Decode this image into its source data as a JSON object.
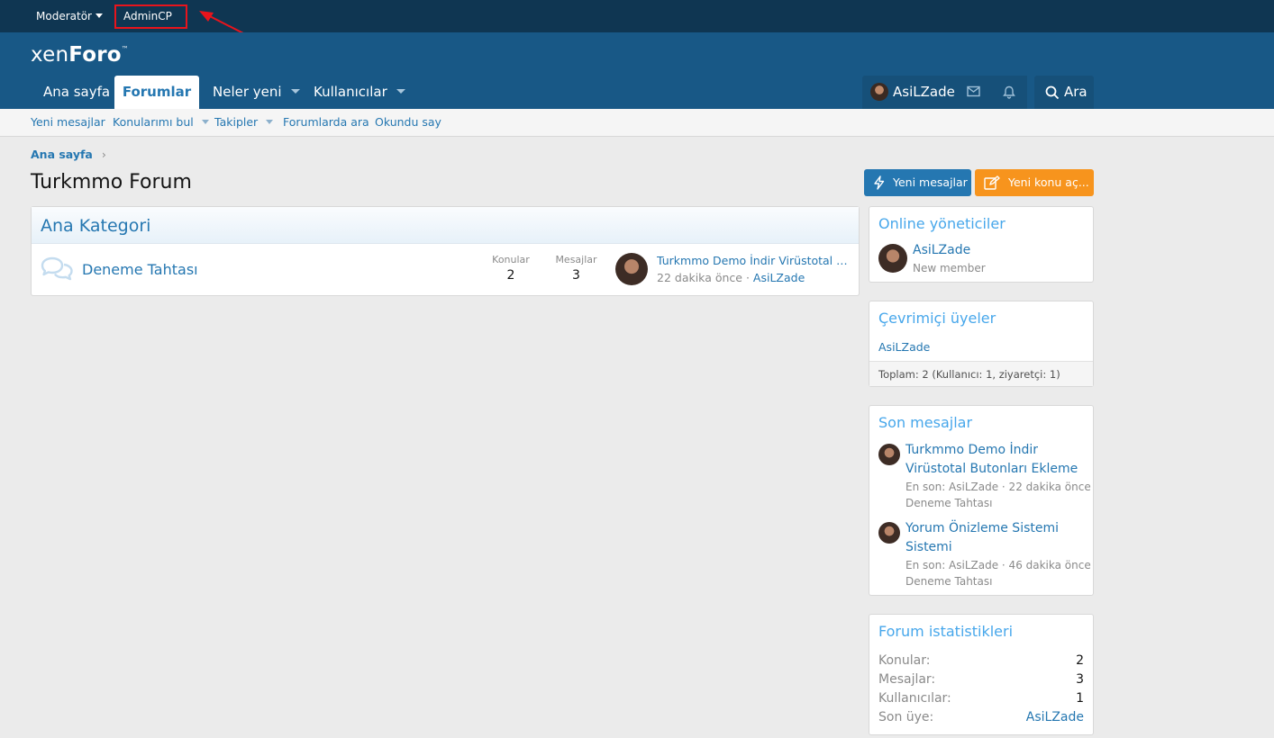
{
  "staff_bar": {
    "moderator_label": "Moderatör",
    "admincp_label": "AdminCP"
  },
  "logo": {
    "part1": "xen",
    "part2": "Foro",
    "tm": "™"
  },
  "nav": {
    "tabs": [
      {
        "label": "Ana sayfa"
      },
      {
        "label": "Forumlar"
      },
      {
        "label": "Neler yeni"
      },
      {
        "label": "Kullanıcılar"
      }
    ],
    "user_label": "AsiLZade",
    "search_label": "Ara"
  },
  "subnav": {
    "items": [
      {
        "label": "Yeni mesajlar"
      },
      {
        "label": "Konularımı bul"
      },
      {
        "label": "Takipler"
      },
      {
        "label": "Forumlarda ara"
      },
      {
        "label": "Okundu say"
      }
    ]
  },
  "breadcrumb": {
    "home": "Ana sayfa",
    "sep": "›"
  },
  "page": {
    "title": "Turkmmo Forum",
    "btn_new_posts": "Yeni mesajlar",
    "btn_new_thread": "Yeni konu aç..."
  },
  "category": {
    "title": "Ana Kategori",
    "forum": {
      "title": "Deneme Tahtası",
      "threads_label": "Konular",
      "threads_value": "2",
      "messages_label": "Mesajlar",
      "messages_value": "3",
      "last_post_title": "Turkmmo Demo İndir Virüstotal Butonları Ekleme",
      "last_post_time": "22 dakika önce",
      "last_post_sep": " · ",
      "last_post_user": "AsiLZade"
    }
  },
  "sidebar": {
    "staff_online": {
      "title": "Online yöneticiler",
      "user": "AsiLZade",
      "user_title": "New member"
    },
    "members_online": {
      "title": "Çevrimiçi üyeler",
      "user": "AsiLZade",
      "footer": "Toplam: 2 (Kullanıcı: 1, ziyaretçi: 1)"
    },
    "new_posts": {
      "title": "Son mesajlar",
      "items": [
        {
          "title_line1": "Turkmmo Demo İndir",
          "title_line2": "Virüstotal Butonları Ekleme",
          "meta": "En son: AsiLZade · 22 dakika önce",
          "forum": "Deneme Tahtası"
        },
        {
          "title_line1": "Yorum Önizleme Sistemi",
          "title_line2": "Sistemi",
          "meta": "En son: AsiLZade · 46 dakika önce",
          "forum": "Deneme Tahtası"
        }
      ]
    },
    "forum_stats": {
      "title": "Forum istatistikleri",
      "rows": [
        {
          "label": "Konular:",
          "value": "2"
        },
        {
          "label": "Mesajlar:",
          "value": "3"
        },
        {
          "label": "Kullanıcılar:",
          "value": "1"
        },
        {
          "label": "Son üye:",
          "value": "AsiLZade"
        }
      ]
    }
  },
  "colors": {
    "staff_bar": "#0f3652",
    "header": "#185886",
    "link": "#2577b1",
    "accent_orange": "#f7941d",
    "annotation": "#e8141c"
  }
}
